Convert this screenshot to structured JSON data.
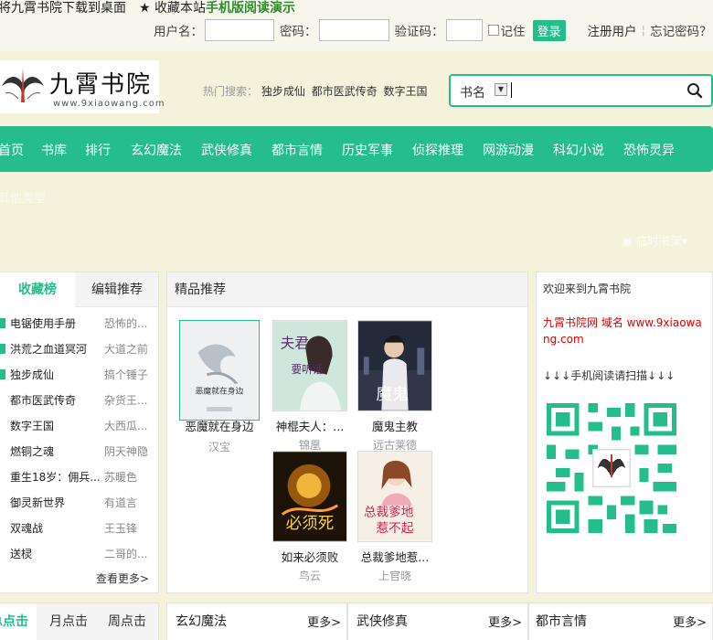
{
  "topbar": {
    "bookmark_text": "将九霄书院下载到桌面",
    "star_icon": "star-icon",
    "favorite_text": "收藏本站",
    "mobile_text": "手机版阅读演示",
    "username_label": "用户名：",
    "password_label": "密码：",
    "captcha_label": "验证码：",
    "remember_label": "记住",
    "login_button": "登录",
    "register_link": "注册用户",
    "forgot_link": "忘记密码？"
  },
  "header": {
    "logo_name": "九霄书院",
    "logo_url": "www.9xiaowang.com",
    "hot_label": "热门搜索：",
    "hot_links": [
      "独步成仙",
      "都市医武传奇",
      "数字王国"
    ],
    "search_category": "书名",
    "search_icon": "magnifier-icon"
  },
  "nav": {
    "items": [
      "首页",
      "书库",
      "排行",
      "玄幻魔法",
      "武侠修真",
      "都市言情",
      "历史军事",
      "侦探推理",
      "网游动漫",
      "科幻小说",
      "恐怖灵异"
    ],
    "other": "其他类型",
    "temp_shelf": "临时书架▾"
  },
  "rank": {
    "tabs": [
      "收藏榜",
      "编辑推荐"
    ],
    "rows": [
      {
        "title": "电锯使用手册",
        "author": "恐怖的..."
      },
      {
        "title": "洪荒之血道冥河",
        "author": "大道之前"
      },
      {
        "title": "独步成仙",
        "author": "搞个锤子"
      },
      {
        "title": "都市医武传奇",
        "author": "杂货王..."
      },
      {
        "title": "数字王国",
        "author": "大西瓜..."
      },
      {
        "title": "燃铜之魂",
        "author": "阴天神隐"
      },
      {
        "title": "重生18岁：佣兵...",
        "author": "苏暖色"
      },
      {
        "title": "御灵新世界",
        "author": "有道言"
      },
      {
        "title": "双魂战",
        "author": "王玉锋"
      },
      {
        "title": "送棂",
        "author": "二哥的..."
      }
    ],
    "more": "查看更多>"
  },
  "recommend": {
    "title": "精品推荐",
    "books": [
      {
        "title": "恶魔就在身边",
        "author": "汉宝"
      },
      {
        "title": "神棍夫人：...",
        "author": "锦凰"
      },
      {
        "title": "魔鬼主教",
        "author": "远古莱德"
      },
      {
        "title": "如来必须败",
        "author": "鸟云"
      },
      {
        "title": "总裁爹地惹...",
        "author": "上官晓"
      }
    ]
  },
  "welcome": {
    "line1": "欢迎来到九霄书院",
    "line2": "九霄书院网 域名 www.9xiaowang.com",
    "line3": "↓↓↓手机阅读请扫描↓↓↓",
    "qr_icon": "qr-code"
  },
  "bottom": {
    "rank_tabs": [
      "总点击",
      "月点击",
      "周点击"
    ],
    "blocks": [
      {
        "title": "玄幻魔法",
        "more": "更多>"
      },
      {
        "title": "武侠修真",
        "more": "更多>"
      },
      {
        "title": "都市言情",
        "more": "更多>"
      }
    ]
  },
  "colors": {
    "accent": "#25bd8c",
    "page_bg": "#f5f2dc",
    "red_text": "#dd0000"
  }
}
